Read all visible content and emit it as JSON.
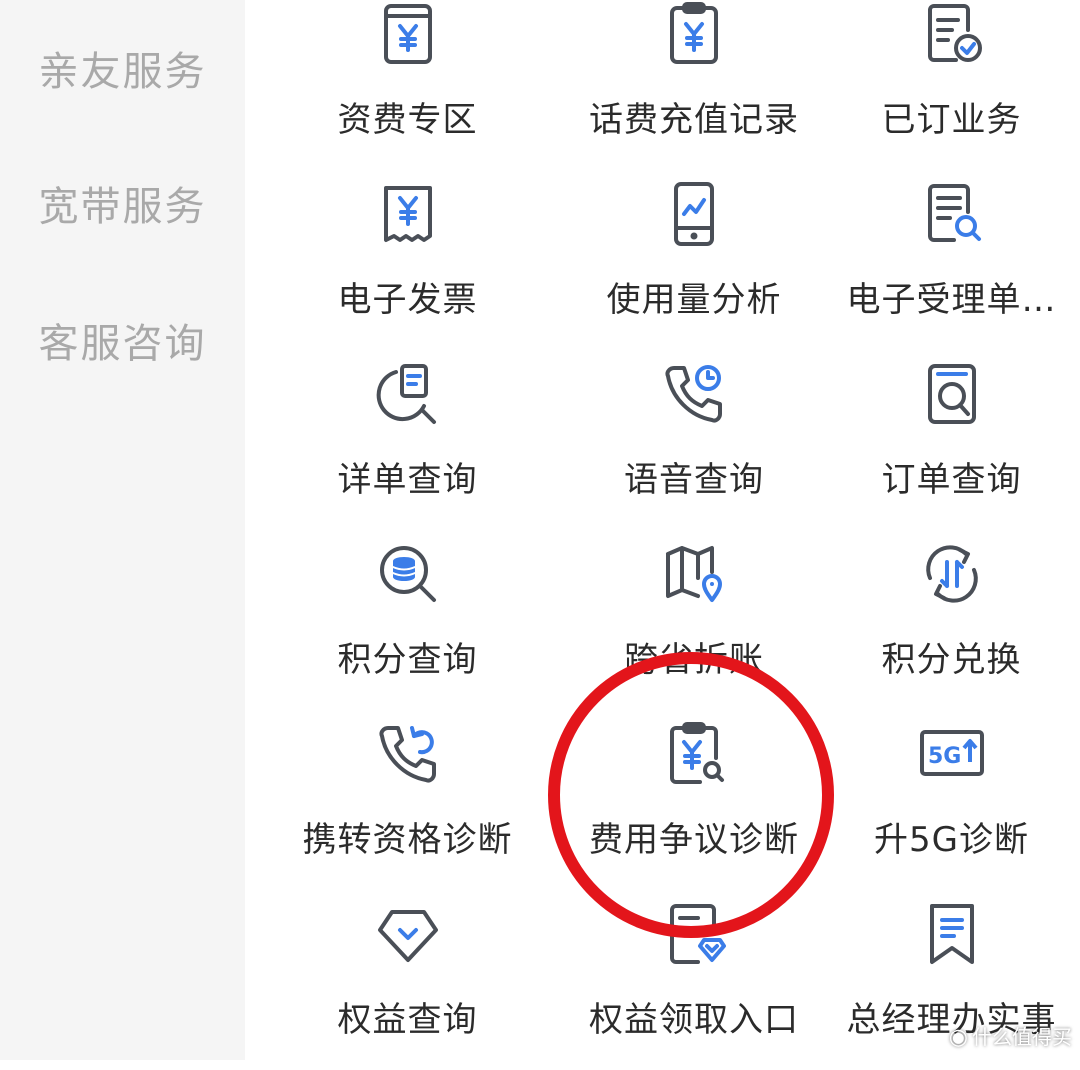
{
  "sidebar": {
    "items": [
      {
        "label": "亲友服务"
      },
      {
        "label": "宽带服务"
      },
      {
        "label": "客服咨询"
      }
    ]
  },
  "services": [
    {
      "label": "资费专区",
      "icon": "yuan-book-icon"
    },
    {
      "label": "话费充值记录",
      "icon": "yuan-clipboard-icon"
    },
    {
      "label": "已订业务",
      "icon": "document-check-icon"
    },
    {
      "label": "电子发票",
      "icon": "yuan-receipt-icon"
    },
    {
      "label": "使用量分析",
      "icon": "phone-chart-icon"
    },
    {
      "label": "电子受理单…",
      "icon": "document-search-icon"
    },
    {
      "label": "详单查询",
      "icon": "list-search-icon"
    },
    {
      "label": "语音查询",
      "icon": "phone-clock-icon"
    },
    {
      "label": "订单查询",
      "icon": "order-search-icon"
    },
    {
      "label": "积分查询",
      "icon": "coins-search-icon"
    },
    {
      "label": "跨省拆账",
      "icon": "map-pin-icon"
    },
    {
      "label": "积分兑换",
      "icon": "exchange-cycle-icon"
    },
    {
      "label": "携转资格诊断",
      "icon": "phone-return-icon"
    },
    {
      "label": "费用争议诊断",
      "icon": "yuan-clipboard-search-icon"
    },
    {
      "label": "升5G诊断",
      "icon": "5g-up-icon"
    },
    {
      "label": "权益查询",
      "icon": "diamond-icon"
    },
    {
      "label": "权益领取入口",
      "icon": "card-diamond-icon"
    },
    {
      "label": "总经理办实事",
      "icon": "bookmark-icon"
    }
  ],
  "icons": {
    "5g_text": "5G"
  },
  "colors": {
    "icon_gray": "#4a4f57",
    "icon_blue": "#3b7de8",
    "highlight_ring": "#e3151b",
    "sidebar_bg": "#f5f5f5"
  },
  "watermark": {
    "text": "什么值得买"
  }
}
